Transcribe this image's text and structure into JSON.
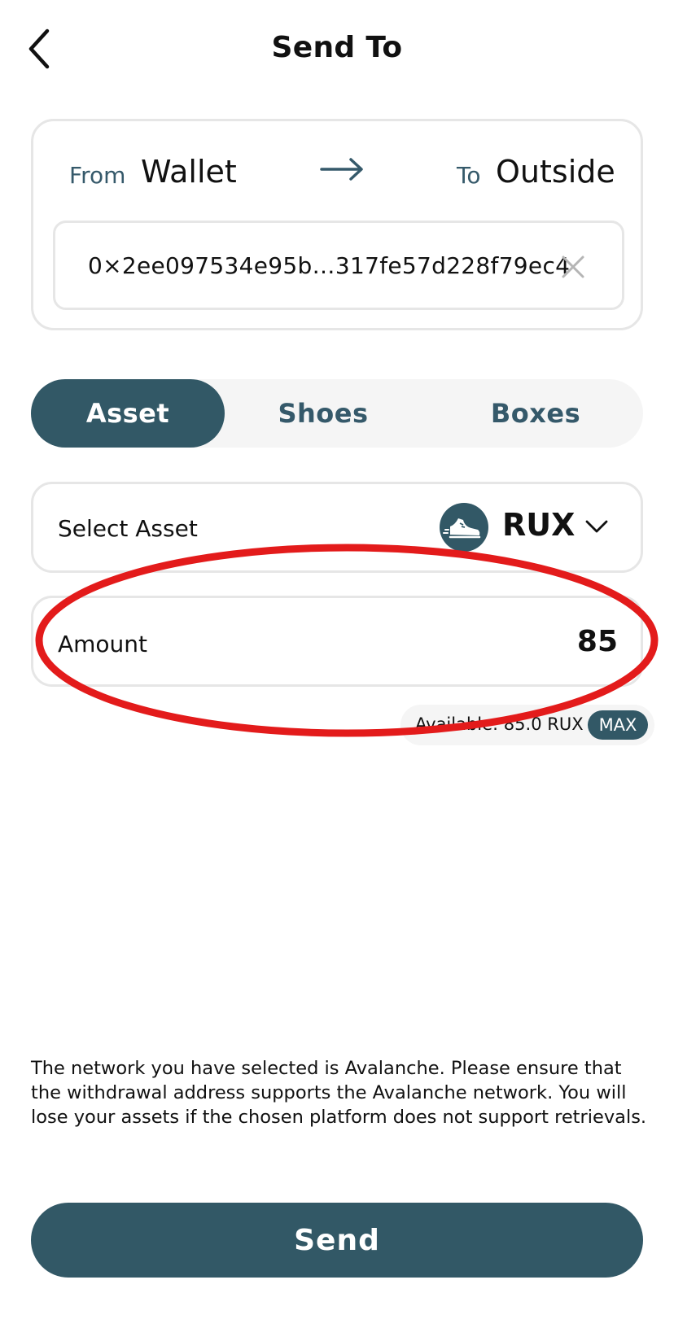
{
  "header": {
    "title": "Send To",
    "back_icon": "chevron-left-icon"
  },
  "transfer": {
    "from_label": "From",
    "from_value": "Wallet",
    "arrow_icon": "arrow-right-icon",
    "to_label": "To",
    "to_value": "Outside",
    "address": "0×2ee097534e95b…317fe57d228f79ec4",
    "clear_icon": "close-icon"
  },
  "tabs": [
    {
      "label": "Asset",
      "active": true
    },
    {
      "label": "Shoes",
      "active": false
    },
    {
      "label": "Boxes",
      "active": false
    }
  ],
  "asset_select": {
    "label": "Select Asset",
    "token": "RUX",
    "token_icon": "sneaker-icon",
    "dropdown_icon": "chevron-down-icon"
  },
  "amount": {
    "label": "Amount",
    "value": "85"
  },
  "available": {
    "text": "Available: 85.0 RUX",
    "max_label": "MAX"
  },
  "notice": "The network you have selected is Avalanche. Please ensure that the withdrawal address supports the Avalanche network. You will lose your assets if the chosen platform does not support retrievals.",
  "send_label": "Send",
  "colors": {
    "primary": "#325866",
    "accent_text": "#35596a",
    "border": "#e6e6e6",
    "pill_bg": "#f5f5f5",
    "annotation": "#e31b1b"
  }
}
